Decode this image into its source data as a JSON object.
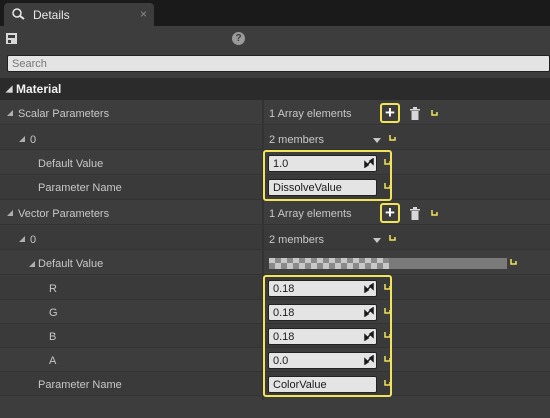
{
  "tab": {
    "title": "Details",
    "close": "×"
  },
  "help": {
    "label": "?"
  },
  "search": {
    "placeholder": "Search"
  },
  "category": {
    "label": "Material"
  },
  "scalar": {
    "label": "Scalar Parameters",
    "summary": "1 Array elements",
    "index": "0",
    "members": "2 members",
    "default_label": "Default Value",
    "default_value": "1.0",
    "name_label": "Parameter Name",
    "name_value": "DissolveValue"
  },
  "vector": {
    "label": "Vector Parameters",
    "summary": "1 Array elements",
    "index": "0",
    "members": "2 members",
    "default_label": "Default Value",
    "r_label": "R",
    "r_value": "0.18",
    "g_label": "G",
    "g_value": "0.18",
    "b_label": "B",
    "b_value": "0.18",
    "a_label": "A",
    "a_value": "0.0",
    "name_label": "Parameter Name",
    "name_value": "ColorValue"
  },
  "colors": {
    "highlight": "#f2e35a",
    "reset": "#f2e35a",
    "panel": "#3d3d3d",
    "header": "#2b2b2b"
  }
}
